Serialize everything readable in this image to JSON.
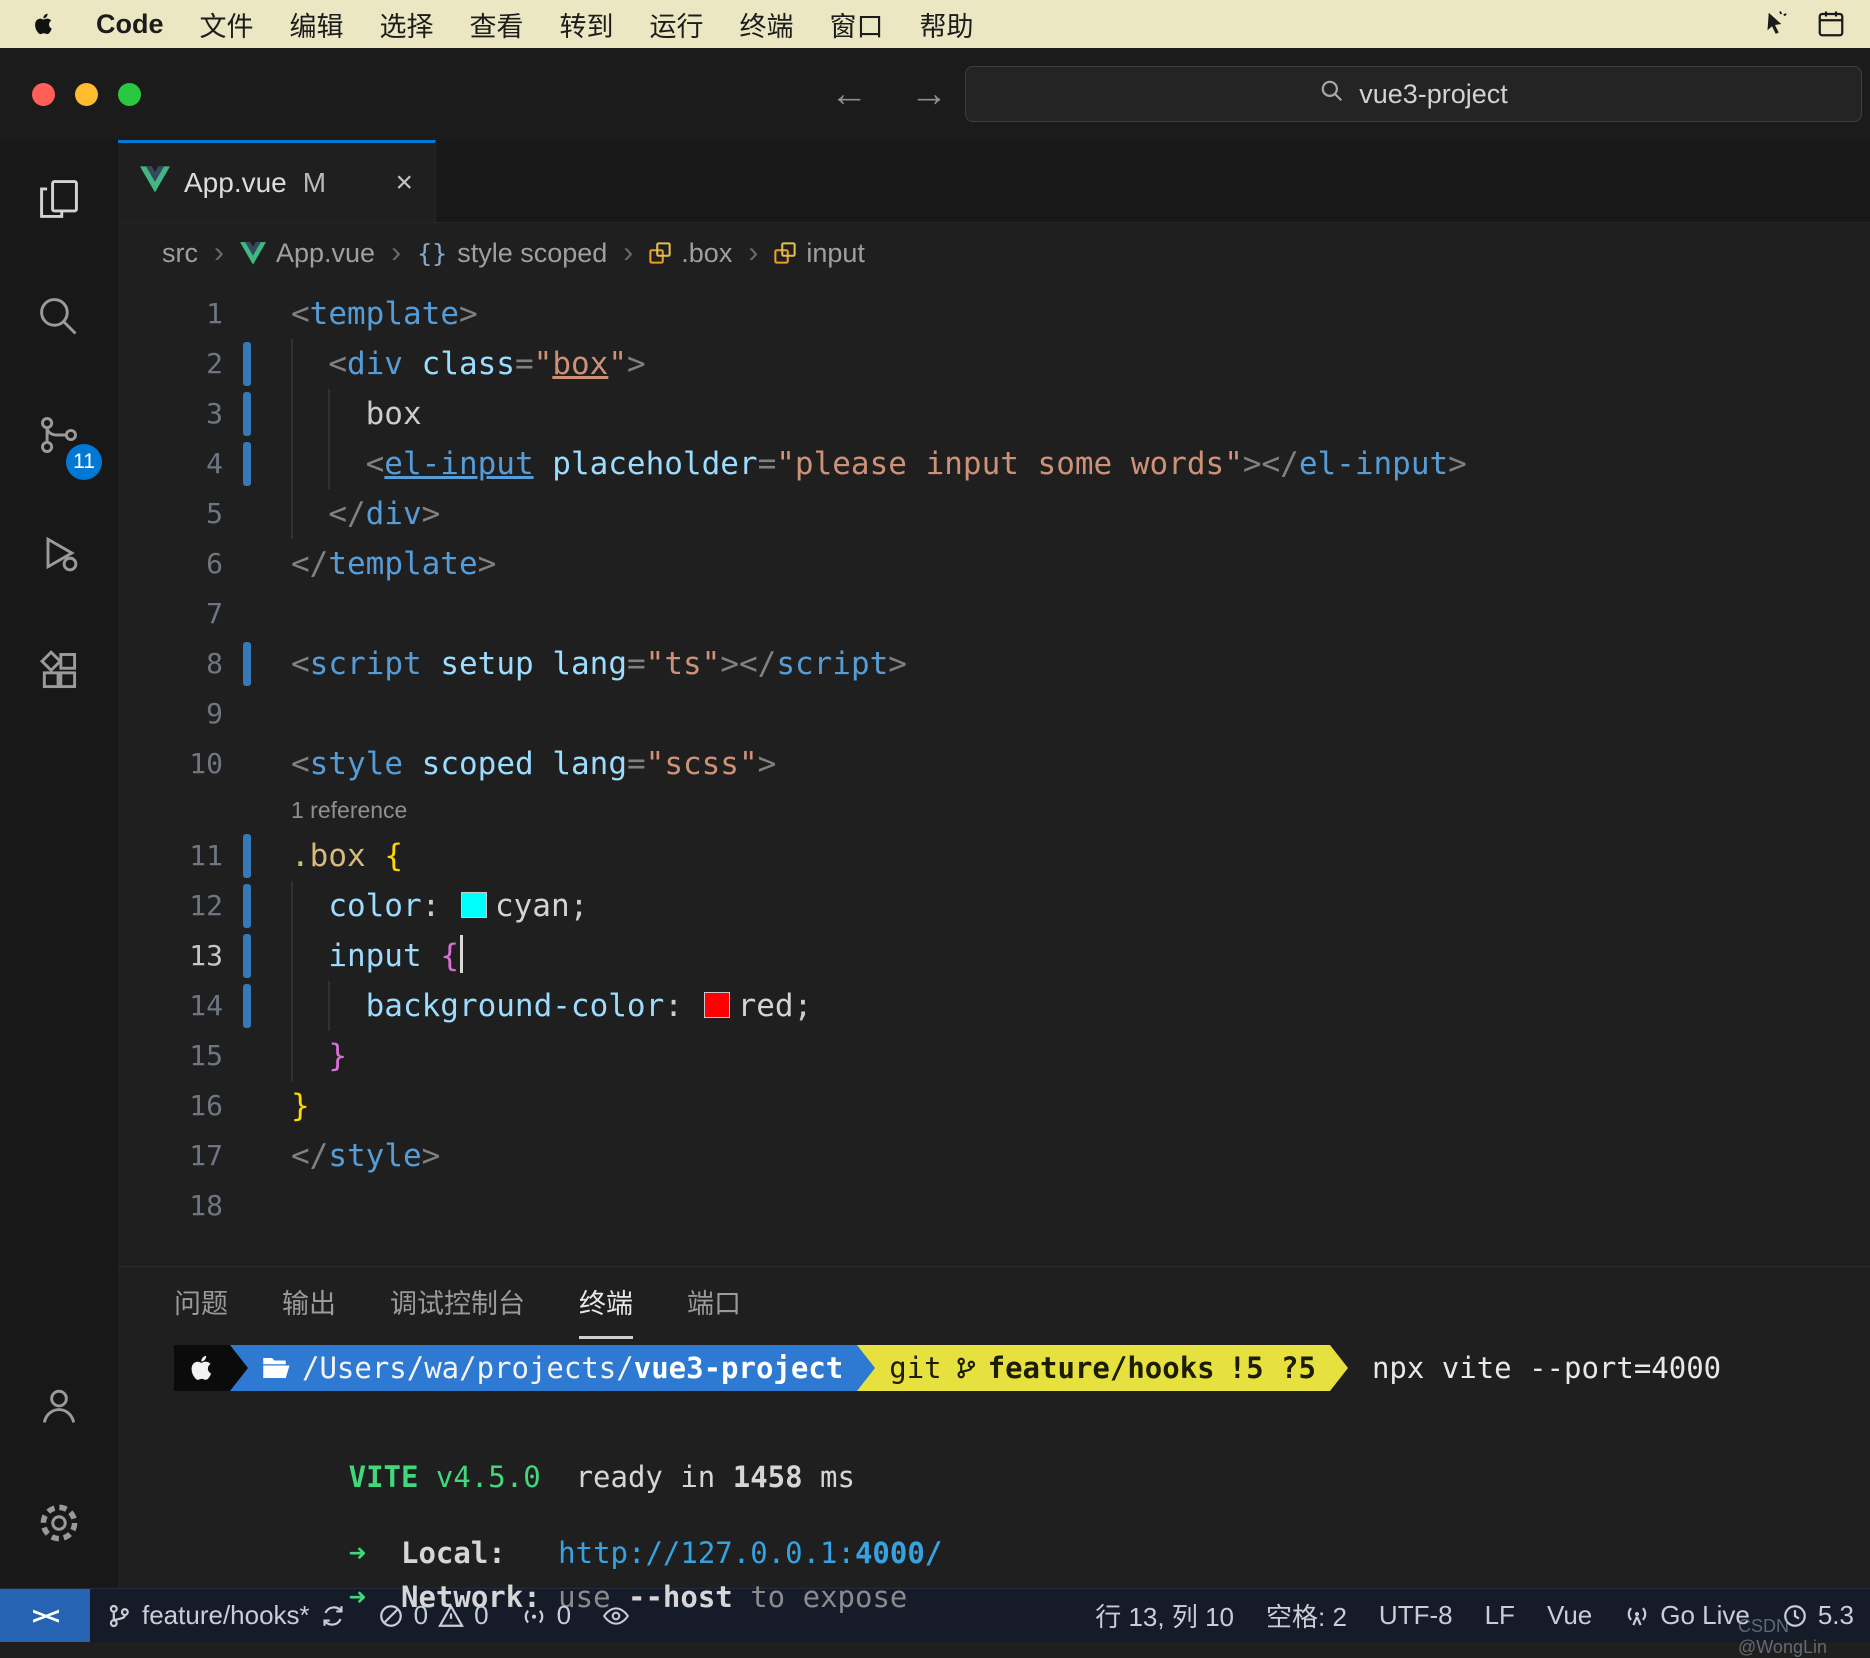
{
  "menubar": {
    "items": [
      "Code",
      "文件",
      "编辑",
      "选择",
      "查看",
      "转到",
      "运行",
      "终端",
      "窗口",
      "帮助"
    ]
  },
  "titlebar": {
    "search_value": "vue3-project"
  },
  "icons": {
    "back": "←",
    "forward": "→",
    "breadcrumb_sep": "›",
    "tab_close": "×",
    "remote": "><"
  },
  "activitybar": {
    "scm_badge": "11"
  },
  "tab": {
    "label": "App.vue",
    "modified": "M"
  },
  "breadcrumbs": [
    {
      "label": "src"
    },
    {
      "icon": "vue",
      "label": "App.vue"
    },
    {
      "icon": "braces",
      "label": "style scoped"
    },
    {
      "icon": "sym",
      "label": ".box"
    },
    {
      "icon": "sym",
      "label": "input"
    }
  ],
  "editor": {
    "active_line": 13,
    "modified_lines": [
      2,
      3,
      4,
      8,
      11,
      12,
      13,
      14
    ],
    "codelens": {
      "line": 11,
      "text": "1 reference"
    },
    "lines": [
      {
        "n": 1,
        "t": [
          [
            "p",
            "<"
          ],
          [
            "tag",
            "template"
          ],
          [
            "p",
            ">"
          ]
        ]
      },
      {
        "n": 2,
        "t": [
          [
            "ind",
            ""
          ],
          [
            "p",
            "<"
          ],
          [
            "tag",
            "div"
          ],
          [
            "txt",
            " "
          ],
          [
            "attr",
            "class"
          ],
          [
            "p",
            "="
          ],
          [
            "str",
            "\""
          ],
          [
            "stru",
            "box"
          ],
          [
            "str",
            "\""
          ],
          [
            "p",
            ">"
          ]
        ]
      },
      {
        "n": 3,
        "t": [
          [
            "ind",
            ""
          ],
          [
            "ind",
            ""
          ],
          [
            "txt",
            "box"
          ]
        ]
      },
      {
        "n": 4,
        "t": [
          [
            "ind",
            ""
          ],
          [
            "ind",
            ""
          ],
          [
            "p",
            "<"
          ],
          [
            "tagu",
            "el-input"
          ],
          [
            "txt",
            " "
          ],
          [
            "attr",
            "placeholder"
          ],
          [
            "p",
            "="
          ],
          [
            "str",
            "\"please input some words\""
          ],
          [
            "p",
            "></"
          ],
          [
            "tag",
            "el-input"
          ],
          [
            "p",
            ">"
          ]
        ]
      },
      {
        "n": 5,
        "t": [
          [
            "ind",
            ""
          ],
          [
            "p",
            "</"
          ],
          [
            "tag",
            "div"
          ],
          [
            "p",
            ">"
          ]
        ]
      },
      {
        "n": 6,
        "t": [
          [
            "p",
            "</"
          ],
          [
            "tag",
            "template"
          ],
          [
            "p",
            ">"
          ]
        ]
      },
      {
        "n": 7,
        "t": []
      },
      {
        "n": 8,
        "t": [
          [
            "p",
            "<"
          ],
          [
            "tag",
            "script"
          ],
          [
            "txt",
            " "
          ],
          [
            "attr",
            "setup"
          ],
          [
            "txt",
            " "
          ],
          [
            "attr",
            "lang"
          ],
          [
            "p",
            "="
          ],
          [
            "str",
            "\"ts\""
          ],
          [
            "p",
            "></"
          ],
          [
            "tag",
            "script"
          ],
          [
            "p",
            ">"
          ]
        ]
      },
      {
        "n": 9,
        "t": []
      },
      {
        "n": 10,
        "t": [
          [
            "p",
            "<"
          ],
          [
            "tag",
            "style"
          ],
          [
            "txt",
            " "
          ],
          [
            "attr",
            "scoped"
          ],
          [
            "txt",
            " "
          ],
          [
            "attr",
            "lang"
          ],
          [
            "p",
            "="
          ],
          [
            "str",
            "\"scss\""
          ],
          [
            "p",
            ">"
          ]
        ]
      },
      {
        "n": 11,
        "t": [
          [
            "sel",
            ".box"
          ],
          [
            "txt",
            " "
          ],
          [
            "b1",
            "{"
          ]
        ]
      },
      {
        "n": 12,
        "t": [
          [
            "ind",
            ""
          ],
          [
            "prop",
            "color"
          ],
          [
            "txt",
            ": "
          ],
          [
            "sw",
            "#00ffff"
          ],
          [
            "val",
            "cyan"
          ],
          [
            "txt",
            ";"
          ]
        ]
      },
      {
        "n": 13,
        "t": [
          [
            "ind",
            ""
          ],
          [
            "elsel",
            "input"
          ],
          [
            "txt",
            " "
          ],
          [
            "b2",
            "{"
          ],
          [
            "cur",
            ""
          ]
        ]
      },
      {
        "n": 14,
        "t": [
          [
            "ind",
            ""
          ],
          [
            "ind",
            ""
          ],
          [
            "prop",
            "background-color"
          ],
          [
            "txt",
            ": "
          ],
          [
            "sw",
            "#ff0000"
          ],
          [
            "val",
            "red"
          ],
          [
            "txt",
            ";"
          ]
        ]
      },
      {
        "n": 15,
        "t": [
          [
            "ind",
            ""
          ],
          [
            "b2",
            "}"
          ]
        ]
      },
      {
        "n": 16,
        "t": [
          [
            "b1",
            "}"
          ]
        ]
      },
      {
        "n": 17,
        "t": [
          [
            "p",
            "</"
          ],
          [
            "tag",
            "style"
          ],
          [
            "p",
            ">"
          ]
        ]
      },
      {
        "n": 18,
        "t": []
      }
    ]
  },
  "panel": {
    "tabs": [
      "问题",
      "输出",
      "调试控制台",
      "终端",
      "端口"
    ],
    "active_index": 3
  },
  "terminal": {
    "prompt": {
      "path_prefix": "/Users/wa/projects/",
      "project": "vue3-project",
      "vcs": "git",
      "branch": "feature/hooks",
      "status": "!5 ?5",
      "command": "npx vite --port=4000"
    },
    "vite": {
      "name": "VITE",
      "version": " v4.5.0",
      "ready_prefix": "  ready in ",
      "ready_bold": "1458",
      "ready_suffix": " ms"
    },
    "local": {
      "arrow": "➜",
      "label": "  Local:",
      "gap": "   ",
      "url": "http://127.0.0.1:",
      "port": "4000/"
    },
    "network": {
      "arrow": "➜",
      "label": "  Network:",
      "gap": " ",
      "pre_dim": "use ",
      "host": "--host",
      "post_dim": " to expose"
    }
  },
  "statusbar": {
    "branch": "feature/hooks*",
    "errors": "0",
    "warnings": "0",
    "ports": "0",
    "line_col": "行 13, 列 10",
    "spaces": "空格: 2",
    "encoding": "UTF-8",
    "eol": "LF",
    "language": "Vue",
    "golive": "Go Live",
    "timer": "5.3"
  },
  "watermark": "CSDN @WongLin",
  "colors": {
    "accent": "#0078d4",
    "vue_green": "#41b883",
    "terminal_blue": "#2e79d2",
    "terminal_yellow": "#e6e13e",
    "vite_green": "#42d77d",
    "link_cyan": "#36a3e0",
    "git_modified": "#3678b8",
    "swatch_cyan": "#00ffff",
    "swatch_red": "#ff0000"
  }
}
